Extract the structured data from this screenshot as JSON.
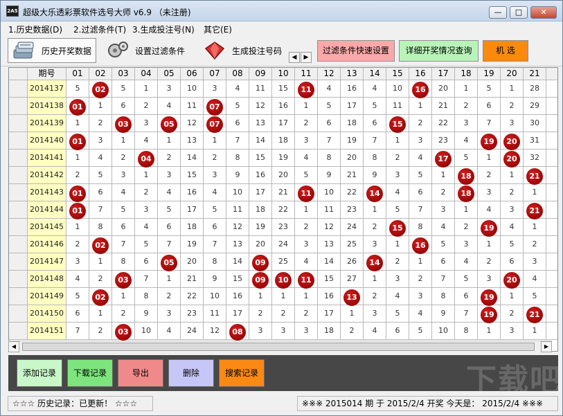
{
  "title": "超级大乐透彩票软件选号大师 v6.9 （未注册)",
  "app_icon_text": "2A5",
  "window_controls": {
    "minimize": "—",
    "maximize": "□",
    "close": "✕"
  },
  "menu": [
    "1.历史数据(D)",
    "2.过滤条件(T)",
    "3.生成投注号(N)",
    "其它(E)"
  ],
  "toolbar": {
    "history": "历史开奖数据",
    "filter": "设置过滤条件",
    "generate": "生成投注号码",
    "quick_filter": "过滤条件快速设置",
    "detail": "详细开奖情况查询",
    "random": "机 选"
  },
  "icons": {
    "history": "database-icon",
    "filter": "gears-icon",
    "generate": "gem-icon"
  },
  "colors": {
    "ball": "#b30b0b",
    "issue_bg": "#ffffc2",
    "quick_filter": "#f9a9a9",
    "detail": "#b9f3b9",
    "random": "#f98a0b"
  },
  "grid": {
    "header_issue": "期号",
    "columns": [
      "01",
      "02",
      "03",
      "04",
      "05",
      "06",
      "07",
      "08",
      "09",
      "10",
      "11",
      "12",
      "13",
      "14",
      "15",
      "16",
      "17",
      "18",
      "19",
      "20",
      "21"
    ],
    "rows": [
      {
        "issue": "2014137",
        "cells": [
          "5",
          "02",
          "5",
          "1",
          "3",
          "10",
          "3",
          "4",
          "11",
          "15",
          "11",
          "4",
          "16",
          "4",
          "10",
          "16",
          "20",
          "1",
          "5",
          "1",
          "28"
        ]
      },
      {
        "issue": "2014138",
        "cells": [
          "01",
          "1",
          "6",
          "2",
          "4",
          "11",
          "07",
          "5",
          "12",
          "16",
          "1",
          "5",
          "17",
          "5",
          "11",
          "1",
          "21",
          "2",
          "6",
          "2",
          "29"
        ]
      },
      {
        "issue": "2014139",
        "cells": [
          "1",
          "2",
          "03",
          "3",
          "05",
          "12",
          "07",
          "6",
          "13",
          "17",
          "2",
          "6",
          "18",
          "6",
          "15",
          "2",
          "22",
          "3",
          "7",
          "3",
          "30"
        ]
      },
      {
        "issue": "2014140",
        "cells": [
          "01",
          "3",
          "1",
          "4",
          "1",
          "13",
          "1",
          "7",
          "14",
          "18",
          "3",
          "7",
          "19",
          "7",
          "1",
          "3",
          "23",
          "4",
          "19",
          "20",
          "31"
        ]
      },
      {
        "issue": "2014141",
        "cells": [
          "1",
          "4",
          "2",
          "04",
          "2",
          "14",
          "2",
          "8",
          "15",
          "19",
          "4",
          "8",
          "20",
          "8",
          "2",
          "4",
          "17",
          "5",
          "1",
          "20",
          "32"
        ]
      },
      {
        "issue": "2014142",
        "cells": [
          "2",
          "5",
          "3",
          "1",
          "3",
          "15",
          "3",
          "9",
          "16",
          "20",
          "5",
          "9",
          "21",
          "9",
          "3",
          "5",
          "1",
          "18",
          "2",
          "1",
          "21"
        ]
      },
      {
        "issue": "2014143",
        "cells": [
          "01",
          "6",
          "4",
          "2",
          "4",
          "16",
          "4",
          "10",
          "17",
          "21",
          "11",
          "10",
          "22",
          "14",
          "4",
          "6",
          "2",
          "18",
          "3",
          "2",
          "1"
        ]
      },
      {
        "issue": "2014144",
        "cells": [
          "01",
          "7",
          "5",
          "3",
          "5",
          "17",
          "5",
          "11",
          "18",
          "22",
          "1",
          "11",
          "23",
          "1",
          "5",
          "7",
          "3",
          "1",
          "4",
          "3",
          "21"
        ]
      },
      {
        "issue": "2014145",
        "cells": [
          "1",
          "8",
          "6",
          "4",
          "6",
          "18",
          "6",
          "12",
          "19",
          "23",
          "2",
          "12",
          "24",
          "2",
          "15",
          "8",
          "4",
          "2",
          "19",
          "4",
          "1"
        ]
      },
      {
        "issue": "2014146",
        "cells": [
          "2",
          "02",
          "7",
          "5",
          "7",
          "19",
          "7",
          "13",
          "20",
          "24",
          "3",
          "13",
          "25",
          "3",
          "1",
          "16",
          "5",
          "3",
          "1",
          "5",
          "2"
        ]
      },
      {
        "issue": "2014147",
        "cells": [
          "3",
          "1",
          "8",
          "6",
          "05",
          "20",
          "8",
          "14",
          "09",
          "25",
          "4",
          "14",
          "26",
          "14",
          "2",
          "1",
          "6",
          "4",
          "2",
          "6",
          "3"
        ]
      },
      {
        "issue": "2014148",
        "cells": [
          "4",
          "2",
          "03",
          "7",
          "1",
          "21",
          "9",
          "15",
          "09",
          "10",
          "11",
          "15",
          "27",
          "1",
          "3",
          "2",
          "7",
          "5",
          "3",
          "20",
          "4"
        ]
      },
      {
        "issue": "2014149",
        "cells": [
          "5",
          "02",
          "1",
          "8",
          "2",
          "22",
          "10",
          "16",
          "1",
          "1",
          "1",
          "16",
          "13",
          "2",
          "4",
          "3",
          "8",
          "6",
          "19",
          "1",
          "5"
        ]
      },
      {
        "issue": "2014150",
        "cells": [
          "6",
          "1",
          "2",
          "9",
          "3",
          "23",
          "11",
          "17",
          "2",
          "2",
          "2",
          "17",
          "1",
          "3",
          "5",
          "4",
          "9",
          "7",
          "19",
          "2",
          "21"
        ]
      },
      {
        "issue": "2014151",
        "cells": [
          "7",
          "2",
          "03",
          "10",
          "4",
          "24",
          "12",
          "08",
          "3",
          "3",
          "3",
          "18",
          "2",
          "4",
          "6",
          "5",
          "10",
          "8",
          "1",
          "3",
          "1"
        ]
      }
    ],
    "balls": [
      [
        2,
        11,
        16
      ],
      [
        1,
        7
      ],
      [
        3,
        5,
        7,
        15
      ],
      [
        1,
        19,
        20
      ],
      [
        4,
        17,
        20
      ],
      [
        18,
        21
      ],
      [
        1,
        11,
        14,
        18
      ],
      [
        1,
        21
      ],
      [
        15,
        19
      ],
      [
        2,
        16
      ],
      [
        5,
        9,
        14
      ],
      [
        3,
        9,
        10,
        11,
        20
      ],
      [
        2,
        13,
        19
      ],
      [
        19,
        21
      ],
      [
        3,
        8
      ]
    ]
  },
  "actions": {
    "add": "添加记录",
    "download": "下载记录",
    "export": "导出",
    "delete": "删除",
    "search": "搜索记录"
  },
  "action_colors": {
    "add": "#c9f7c9",
    "download": "#7ee57e",
    "export": "#f08a8a",
    "delete": "#c7c7f7",
    "search": "#fa8a14"
  },
  "status": {
    "history": "☆☆☆  历史记录：已更新！  ☆☆☆",
    "draw": "※※※  2015014 期 于 2015/2/4 开奖     今天是：  2015/2/4  ※※※"
  },
  "watermark": "下载吧"
}
